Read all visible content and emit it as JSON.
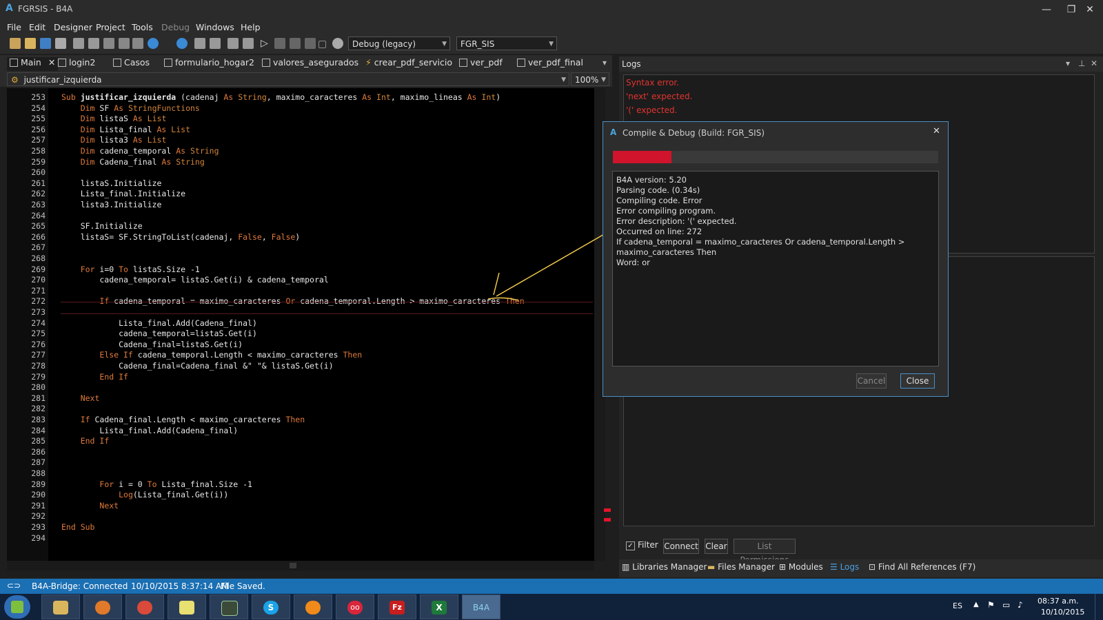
{
  "window": {
    "app_logo": "A",
    "title": "FGRSIS - B4A",
    "controls": [
      "—",
      "❐",
      "✕"
    ]
  },
  "menu": [
    "File",
    "Edit",
    "Designer",
    "Project",
    "Tools",
    "Debug",
    "Windows",
    "Help"
  ],
  "toolbar": {
    "build_config": "Debug (legacy)",
    "build_target": "FGR_SIS"
  },
  "tabs": [
    {
      "label": "Main",
      "closable": true
    },
    {
      "label": "login2"
    },
    {
      "label": "Casos"
    },
    {
      "label": "formulario_hogar2"
    },
    {
      "label": "valores_asegurados"
    },
    {
      "label": "crear_pdf_servicio"
    },
    {
      "label": "ver_pdf"
    },
    {
      "label": "ver_pdf_final"
    }
  ],
  "sub_selector": "justificar_izquierda",
  "zoom": "100%",
  "code": {
    "line_numbers": [
      "253",
      "254",
      "255",
      "256",
      "257",
      "258",
      "259",
      "260",
      "261",
      "262",
      "263",
      "264",
      "265",
      "266",
      "267",
      "268",
      "269",
      "270",
      "271",
      "272",
      "273",
      "274",
      "275",
      "276",
      "277",
      "278",
      "279",
      "280",
      "281",
      "282",
      "283",
      "284",
      "285",
      "286",
      "287",
      "288",
      "289",
      "290",
      "291",
      "292",
      "293",
      "294"
    ],
    "lines": [
      [
        {
          "t": "Sub",
          "c": "kw"
        },
        {
          "t": " justificar_izquierda ",
          "c": "fn"
        },
        {
          "t": "(cadenaj "
        },
        {
          "t": "As",
          "c": "kw"
        },
        {
          "t": " "
        },
        {
          "t": "String",
          "c": "ty"
        },
        {
          "t": ", maximo_caracteres "
        },
        {
          "t": "As",
          "c": "kw"
        },
        {
          "t": " "
        },
        {
          "t": "Int",
          "c": "ty"
        },
        {
          "t": ", maximo_lineas "
        },
        {
          "t": "As",
          "c": "kw"
        },
        {
          "t": " "
        },
        {
          "t": "Int",
          "c": "ty"
        },
        {
          "t": ")"
        }
      ],
      [
        {
          "t": "    "
        },
        {
          "t": "Dim",
          "c": "kw"
        },
        {
          "t": " SF "
        },
        {
          "t": "As",
          "c": "kw"
        },
        {
          "t": " "
        },
        {
          "t": "StringFunctions",
          "c": "ty"
        }
      ],
      [
        {
          "t": "    "
        },
        {
          "t": "Dim",
          "c": "kw"
        },
        {
          "t": " listaS "
        },
        {
          "t": "As",
          "c": "kw"
        },
        {
          "t": " "
        },
        {
          "t": "List",
          "c": "ty"
        }
      ],
      [
        {
          "t": "    "
        },
        {
          "t": "Dim",
          "c": "kw"
        },
        {
          "t": " Lista_final "
        },
        {
          "t": "As",
          "c": "kw"
        },
        {
          "t": " "
        },
        {
          "t": "List",
          "c": "ty"
        }
      ],
      [
        {
          "t": "    "
        },
        {
          "t": "Dim",
          "c": "kw"
        },
        {
          "t": " lista3 "
        },
        {
          "t": "As",
          "c": "kw"
        },
        {
          "t": " "
        },
        {
          "t": "List",
          "c": "ty"
        }
      ],
      [
        {
          "t": "    "
        },
        {
          "t": "Dim",
          "c": "kw"
        },
        {
          "t": " cadena_temporal "
        },
        {
          "t": "As",
          "c": "kw"
        },
        {
          "t": " "
        },
        {
          "t": "String",
          "c": "ty"
        }
      ],
      [
        {
          "t": "    "
        },
        {
          "t": "Dim",
          "c": "kw"
        },
        {
          "t": " Cadena_final "
        },
        {
          "t": "As",
          "c": "kw"
        },
        {
          "t": " "
        },
        {
          "t": "String",
          "c": "ty"
        }
      ],
      [],
      [
        {
          "t": "    listaS.Initialize"
        }
      ],
      [
        {
          "t": "    Lista_final.Initialize"
        }
      ],
      [
        {
          "t": "    lista3.Initialize"
        }
      ],
      [],
      [
        {
          "t": "    SF.Initialize"
        }
      ],
      [
        {
          "t": "    listaS= SF.StringToList(cadenaj, "
        },
        {
          "t": "False",
          "c": "kw"
        },
        {
          "t": ", "
        },
        {
          "t": "False",
          "c": "kw"
        },
        {
          "t": ")"
        }
      ],
      [],
      [],
      [
        {
          "t": "    "
        },
        {
          "t": "For",
          "c": "kw"
        },
        {
          "t": " i=0 "
        },
        {
          "t": "To",
          "c": "kw"
        },
        {
          "t": " listaS.Size -1"
        }
      ],
      [
        {
          "t": "        cadena_temporal= listaS.Get(i) & cadena_temporal"
        }
      ],
      [],
      [
        {
          "t": "        "
        },
        {
          "t": "If",
          "c": "kw"
        },
        {
          "t": " cadena_temporal = maximo_caracteres "
        },
        {
          "t": "Or",
          "c": "kw"
        },
        {
          "t": " cadena_temporal.Length > maximo_caracteres "
        },
        {
          "t": "Then",
          "c": "kw"
        }
      ],
      [],
      [
        {
          "t": "            Lista_final.Add(Cadena_final)"
        }
      ],
      [
        {
          "t": "            cadena_temporal=listaS.Get(i)"
        }
      ],
      [
        {
          "t": "            Cadena_final=listaS.Get(i)"
        }
      ],
      [
        {
          "t": "        "
        },
        {
          "t": "Else If",
          "c": "kw"
        },
        {
          "t": " cadena_temporal.Length < maximo_caracteres "
        },
        {
          "t": "Then",
          "c": "kw"
        }
      ],
      [
        {
          "t": "            Cadena_final=Cadena_final &\" \"& listaS.Get(i)"
        }
      ],
      [
        {
          "t": "        "
        },
        {
          "t": "End If",
          "c": "kw"
        }
      ],
      [],
      [
        {
          "t": "    "
        },
        {
          "t": "Next",
          "c": "kw"
        }
      ],
      [],
      [
        {
          "t": "    "
        },
        {
          "t": "If",
          "c": "kw"
        },
        {
          "t": " Cadena_final.Length < maximo_caracteres "
        },
        {
          "t": "Then",
          "c": "kw"
        }
      ],
      [
        {
          "t": "        Lista_final.Add(Cadena_final)"
        }
      ],
      [
        {
          "t": "    "
        },
        {
          "t": "End If",
          "c": "kw"
        }
      ],
      [],
      [],
      [],
      [
        {
          "t": "        "
        },
        {
          "t": "For",
          "c": "kw"
        },
        {
          "t": " i = 0 "
        },
        {
          "t": "To",
          "c": "kw"
        },
        {
          "t": " Lista_final.Size -1"
        }
      ],
      [
        {
          "t": "            "
        },
        {
          "t": "Log",
          "c": "kw"
        },
        {
          "t": "(Lista_final.Get(i))"
        }
      ],
      [
        {
          "t": "        "
        },
        {
          "t": "Next",
          "c": "kw"
        }
      ],
      [],
      [
        {
          "t": "End Sub",
          "c": "kw"
        }
      ],
      []
    ]
  },
  "logs": {
    "title": "Logs",
    "errors": [
      "Syntax error.",
      "'next' expected.",
      "'(' expected."
    ],
    "filter_label": "Filter",
    "filter_checked": true,
    "connect": "Connect",
    "clear": "Clear",
    "list_permissions": "List Permissions"
  },
  "bottom_tabs": [
    "Libraries Manager",
    "Files Manager",
    "Modules",
    "Logs",
    "Find All References (F7)"
  ],
  "dialog": {
    "logo": "A",
    "title": "Compile & Debug (Build: FGR_SIS)",
    "progress": 0.18,
    "progress_color": "#d0142c",
    "lines": [
      "B4A version: 5.20",
      "Parsing code.    (0.34s)",
      "Compiling code.    Error",
      "Error compiling program.",
      "Error description: '(' expected.",
      "Occurred on line: 272",
      "If cadena_temporal = maximo_caracteres Or cadena_temporal.Length >",
      "maximo_caracteres Then",
      "Word: or"
    ],
    "cancel": "Cancel",
    "close": "Close"
  },
  "status": {
    "bridge": "B4A-Bridge: Connected",
    "timestamp": "10/10/2015 8:37:14 AM",
    "message": "File Saved."
  },
  "taskbar": {
    "apps": [
      "explorer-icon",
      "firefox-icon",
      "chrome-icon",
      "notes-icon",
      "terminal-icon",
      "skype-icon",
      "avast-icon",
      "flickr-icon",
      "filezilla-icon",
      "excel-icon",
      "b4a-icon"
    ],
    "b4a_label": "B4A",
    "filezilla_label": "Fz",
    "excel_label": "X",
    "skype_label": "S",
    "flickr_label": "oo",
    "language": "ES",
    "time": "08:37 a.m.",
    "date": "10/10/2015"
  },
  "colors": {
    "accent": "#1b6fb3",
    "error": "#e3342f",
    "keyword": "#e07a3a",
    "annotation_arrow": "#f2c94c"
  }
}
